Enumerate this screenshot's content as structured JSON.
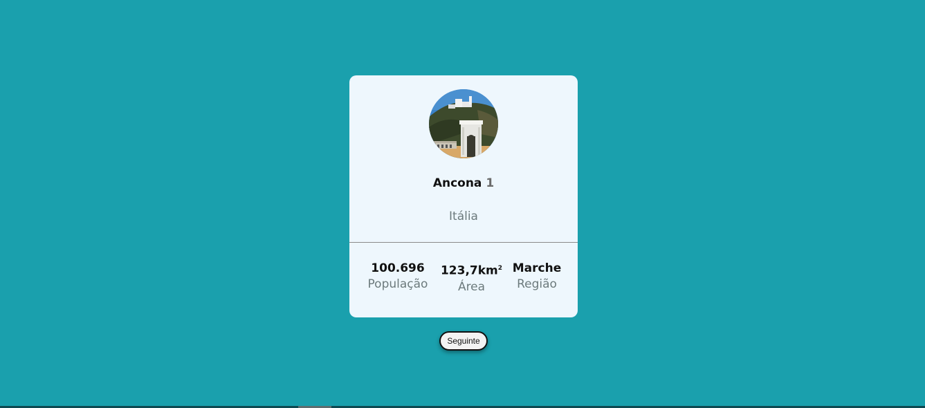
{
  "colors": {
    "background": "#1aa0ad",
    "card": "#eef7fd",
    "muted_text": "#6c7a7c"
  },
  "city": {
    "name": "Ancona",
    "rank": "1",
    "country": "Itália",
    "photo_icon": "city-photo"
  },
  "stats": [
    {
      "value": "100.696",
      "label": "População"
    },
    {
      "value": "123,7km",
      "unit_sup": "2",
      "label": "Área"
    },
    {
      "value": "Marche",
      "label": "Região"
    }
  ],
  "next_button": {
    "label": "Seguinte"
  }
}
